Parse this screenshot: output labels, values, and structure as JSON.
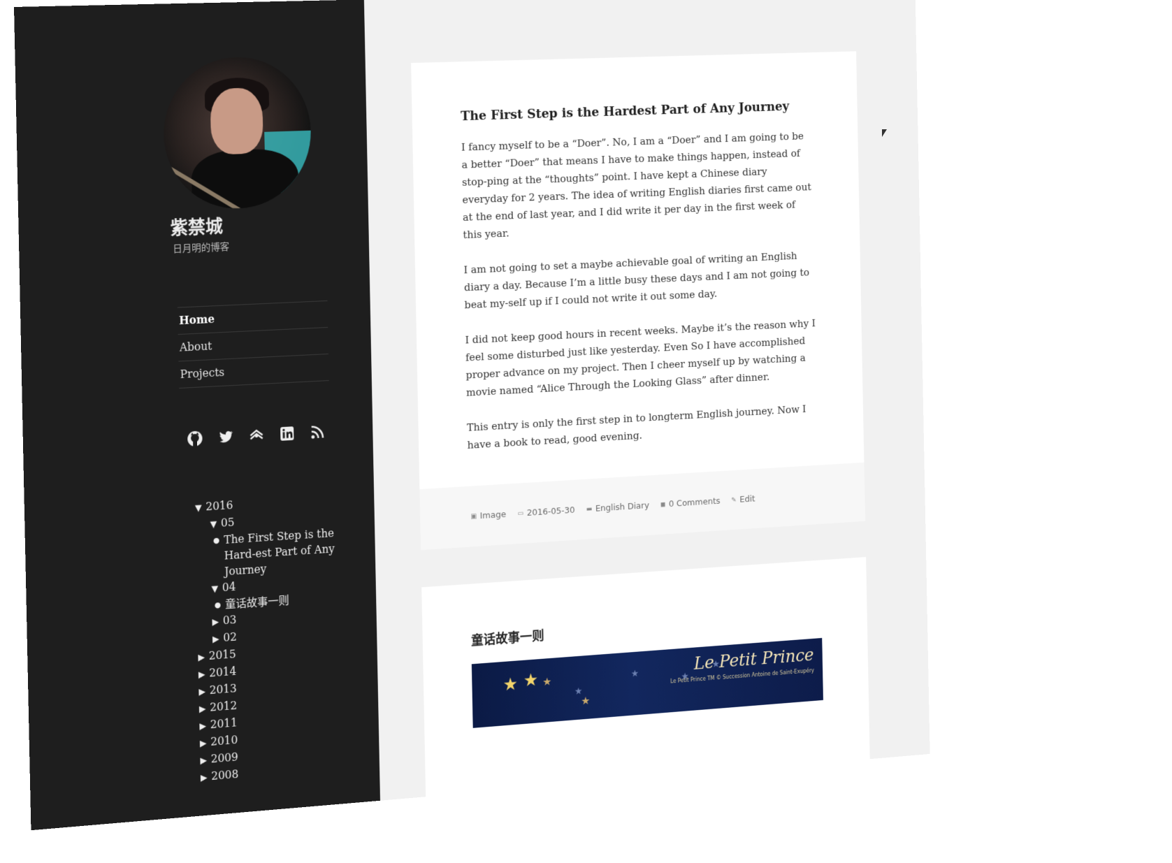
{
  "site": {
    "title": "紫禁城",
    "description": "日月明的博客"
  },
  "nav": {
    "items": [
      {
        "label": "Home",
        "active": true
      },
      {
        "label": "About",
        "active": false
      },
      {
        "label": "Projects",
        "active": false
      }
    ]
  },
  "social": {
    "icons": [
      "github-icon",
      "twitter-icon",
      "douban-icon",
      "linkedin-icon",
      "rss-icon"
    ]
  },
  "archive": {
    "open_marker": "▼",
    "closed_marker": "▶",
    "bullet": "●",
    "year_2016": "2016",
    "month_05": "05",
    "post_05": "The First Step is the Hard-est Part of Any Journey",
    "month_04": "04",
    "post_04": "童话故事一则",
    "month_03": "03",
    "month_02": "02",
    "years": [
      "2015",
      "2014",
      "2013",
      "2012",
      "2011",
      "2010",
      "2009",
      "2008"
    ]
  },
  "post1": {
    "title": "The First Step is the Hardest Part of Any Journey",
    "paragraphs": [
      "I fancy myself to be a “Doer”. No, I am a “Doer” and I am going to be a better “Doer” that means I have to make things happen, instead of stop-ping at the “thoughts” point. I have kept a Chinese diary everyday for 2 years. The idea of writing English diaries first came out at the end of last year, and I did write it per day in the first week of this year.",
      "I am not going to set a maybe achievable goal of writing an English diary a day. Because I’m a little busy these days and I am not going to beat my-self up if I could not write it out some day.",
      "I did not keep good hours in recent weeks. Maybe it’s the reason why I feel some disturbed just like yesterday. Even So I have accomplished proper advance on my project. Then I cheer myself up by watching a movie named “Alice Through the Looking Glass” after dinner.",
      "This entry is only the first step in to longterm English journey. Now I have a book to read, good evening."
    ],
    "meta": {
      "format": "Image",
      "date": "2016-05-30",
      "category": "English Diary",
      "comments": "0 Comments",
      "edit": "Edit"
    }
  },
  "post2": {
    "title": "童话故事一则",
    "banner_title": "Le Petit Prince",
    "banner_sub": "Le Petit Prince TM © Succession Antoine de Saint-Exupéry"
  },
  "colors": {
    "sidebar_bg": "#1e1e1e",
    "page_bg": "#f1f1f1",
    "card_bg": "#ffffff"
  }
}
